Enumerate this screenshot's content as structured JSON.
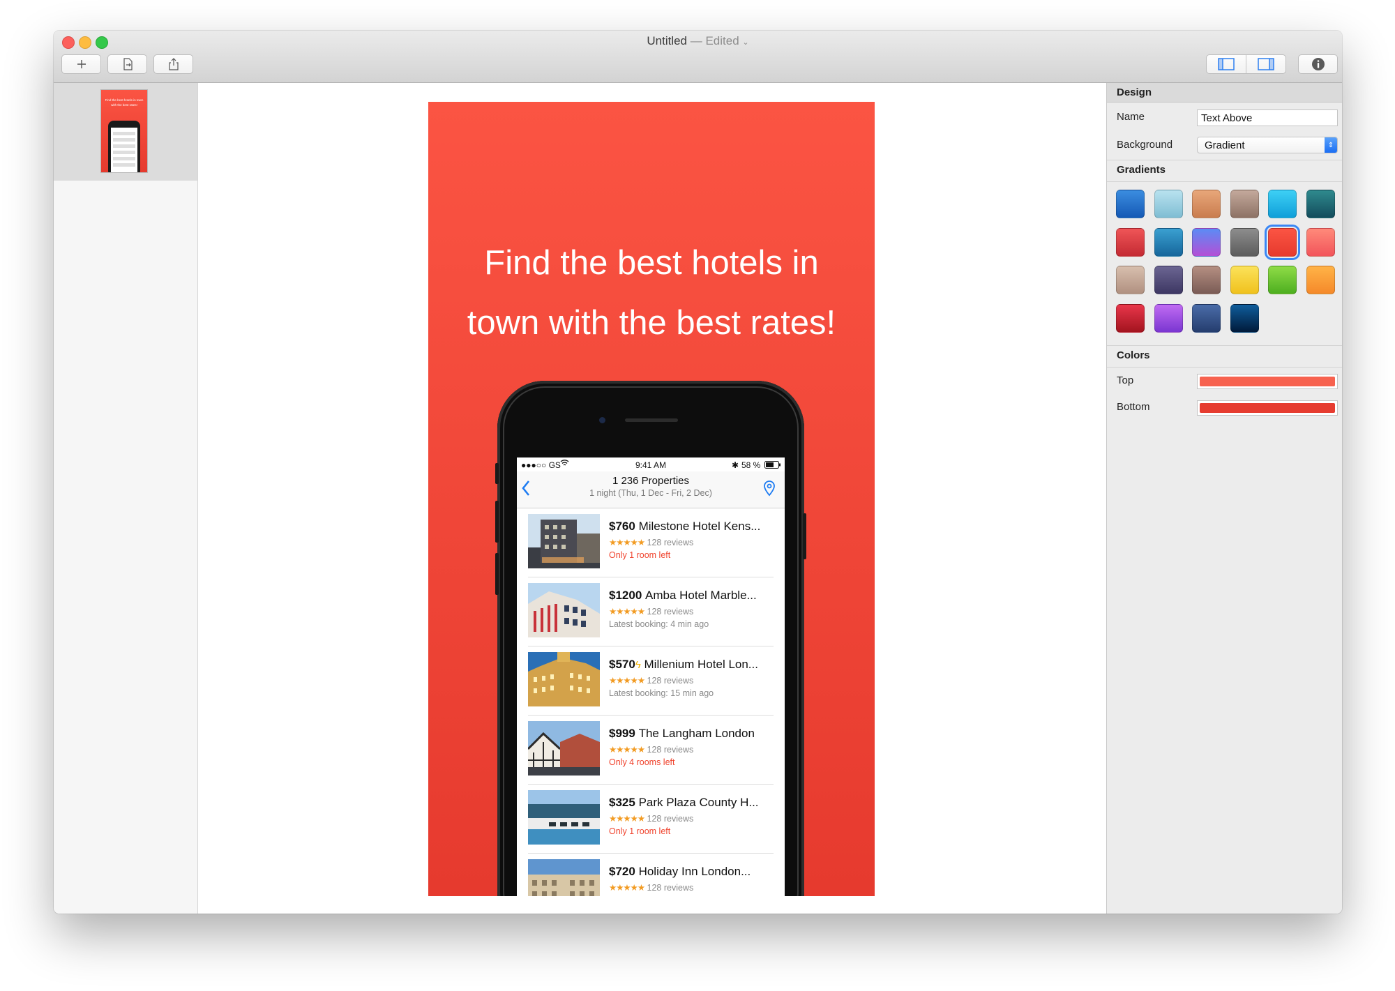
{
  "window": {
    "title": "Untitled",
    "edited": "— Edited"
  },
  "toolbar": {
    "add_icon": "plus-icon",
    "export_icon": "export-file-icon",
    "share_icon": "share-icon",
    "left_sidebar_icon": "sidebar-left-icon",
    "right_sidebar_icon": "sidebar-right-icon",
    "info_icon": "info-icon"
  },
  "thumbnail": {
    "text": "Find the best hotels in town with the best rates!"
  },
  "poster": {
    "headline_line1": "Find the best hotels in",
    "headline_line2": "town with the best rates!",
    "gradient_top": "#fb5443",
    "gradient_bottom": "#e63a2e"
  },
  "phone": {
    "status": {
      "carrier": "●●●○○ GS",
      "time": "9:41 AM",
      "battery": "58 %"
    },
    "nav": {
      "title": "1 236 Properties",
      "subtitle": "1 night (Thu, 1 Dec - Fri, 2 Dec)"
    },
    "hotels": [
      {
        "price": "$760",
        "name": "Milestone Hotel Kens...",
        "stars": "★★★★★",
        "reviews": "128 reviews",
        "note": "Only 1 room left",
        "note_type": "urgent"
      },
      {
        "price": "$1200",
        "name": "Amba Hotel Marble...",
        "stars": "★★★★★",
        "reviews": "128 reviews",
        "note": "Latest booking: 4 min ago",
        "note_type": "info"
      },
      {
        "price": "$570",
        "name": "Millenium Hotel Lon...",
        "stars": "★★★★★",
        "reviews": "128 reviews",
        "note": "Latest booking: 15 min ago",
        "note_type": "info"
      },
      {
        "price": "$999",
        "name": "The Langham London",
        "stars": "★★★★★",
        "reviews": "128 reviews",
        "note": "Only 4 rooms left",
        "note_type": "urgent"
      },
      {
        "price": "$325",
        "name": "Park Plaza County H...",
        "stars": "★★★★★",
        "reviews": "128 reviews",
        "note": "Only 1 room left",
        "note_type": "urgent"
      },
      {
        "price": "$720",
        "name": "Holiday Inn London...",
        "stars": "★★★★★",
        "reviews": "128 reviews",
        "note": "",
        "note_type": "info"
      }
    ]
  },
  "design_panel": {
    "title": "Design",
    "name_label": "Name",
    "name_value": "Text Above",
    "background_label": "Background",
    "background_value": "Gradient",
    "gradients_title": "Gradients",
    "gradients": [
      [
        "#3b8de0",
        "#1559b5"
      ],
      [
        "#b9e2ef",
        "#7fbdd3"
      ],
      [
        "#e8a77a",
        "#c97c4e"
      ],
      [
        "#c4a99c",
        "#8d7265"
      ],
      [
        "#3ed0f5",
        "#0f9fd9"
      ],
      [
        "#2f8a8e",
        "#134c5c"
      ],
      [
        "#ef5557",
        "#c42a33"
      ],
      [
        "#3aa0d1",
        "#16669b"
      ],
      [
        "#5b8cf5",
        "#b44fd6"
      ],
      [
        "#8d8d8d",
        "#5c5c5c"
      ],
      [
        "#fb5443",
        "#e63a2e"
      ],
      [
        "#ff8a7a",
        "#f2545a"
      ],
      [
        "#d8bfae",
        "#b09080"
      ],
      [
        "#6b6592",
        "#3d3763"
      ],
      [
        "#b58f82",
        "#7a5b55"
      ],
      [
        "#fbe25a",
        "#f0c11d"
      ],
      [
        "#8fdc47",
        "#4dae20"
      ],
      [
        "#ffb347",
        "#f5892a"
      ],
      [
        "#e8364a",
        "#a3141f"
      ],
      [
        "#c06bf2",
        "#7a36d1"
      ],
      [
        "#4a6ca8",
        "#253d6e"
      ],
      [
        "#0f5d9b",
        "#001a3a"
      ]
    ],
    "selected_gradient": 10,
    "colors_title": "Colors",
    "top_label": "Top",
    "top_color": "#f7624f",
    "bottom_label": "Bottom",
    "bottom_color": "#e63c30"
  }
}
